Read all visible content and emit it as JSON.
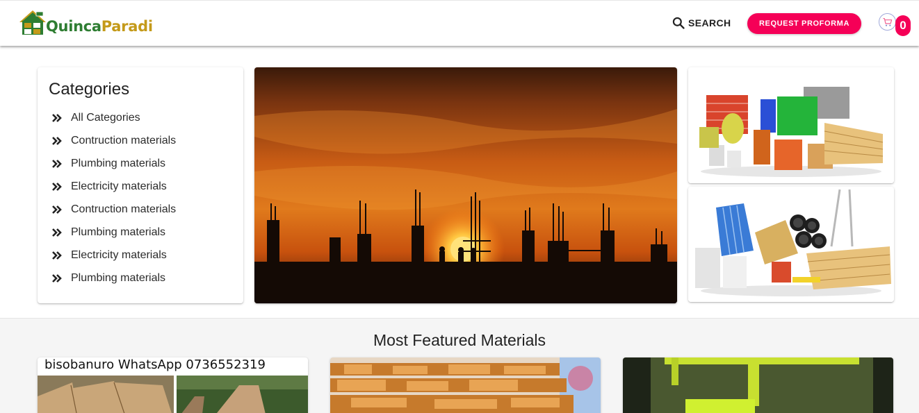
{
  "header": {
    "logo_part1": "Quinca",
    "logo_part2": "Paradi",
    "search_label": "SEARCH",
    "proforma_label": "REQUEST PROFORMA",
    "cart_count": "0"
  },
  "categories": {
    "title": "Categories",
    "items": [
      {
        "label": "All Categories"
      },
      {
        "label": "Contruction materials"
      },
      {
        "label": "Plumbing materials"
      },
      {
        "label": "Electricity materials"
      },
      {
        "label": "Contruction materials"
      },
      {
        "label": "Plumbing materials"
      },
      {
        "label": "Electricity materials"
      },
      {
        "label": "Plumbing materials"
      }
    ]
  },
  "featured": {
    "title": "Most Featured Materials",
    "products": [
      {
        "caption": "bisobanuro WhatsApp 0736552319"
      }
    ]
  },
  "colors": {
    "accent": "#f50057",
    "logo_green": "#2e7d32",
    "logo_gold": "#c49a1a"
  },
  "icons": [
    "search-icon",
    "cart-icon",
    "double-chevron-right-icon"
  ]
}
